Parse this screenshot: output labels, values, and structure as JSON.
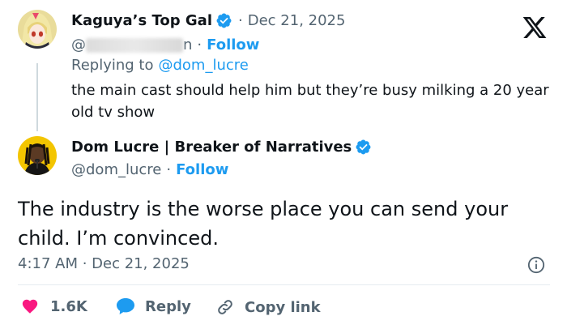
{
  "reply_tweet": {
    "display_name": "Kaguya’s Top Gal",
    "date": "Dec 21, 2025",
    "handle_prefix": "@",
    "handle_suffix": "n",
    "follow_label": "Follow",
    "replying_to_label": "Replying to",
    "replying_to_handle": "@dom_lucre",
    "text": "the main cast should help him but they’re busy milking a 20 year old tv show"
  },
  "main_tweet": {
    "display_name": "Dom Lucre | Breaker of Narratives",
    "handle": "@dom_lucre",
    "follow_label": "Follow",
    "text": "The industry is the worse place you can send your child. I’m convinced.",
    "timestamp": "4:17 AM · Dec 21, 2025"
  },
  "actions": {
    "likes": "1.6K",
    "reply_label": "Reply",
    "copy_link_label": "Copy link"
  },
  "separator": "·",
  "icons": {
    "verified": "verified-badge-icon",
    "x_logo": "x-logo-icon",
    "info": "info-icon",
    "heart": "heart-icon",
    "reply": "speech-bubble-icon",
    "link": "link-icon"
  },
  "colors": {
    "accent": "#1d9bf0",
    "like": "#f91880",
    "text": "#0f1419",
    "muted": "#536471"
  }
}
